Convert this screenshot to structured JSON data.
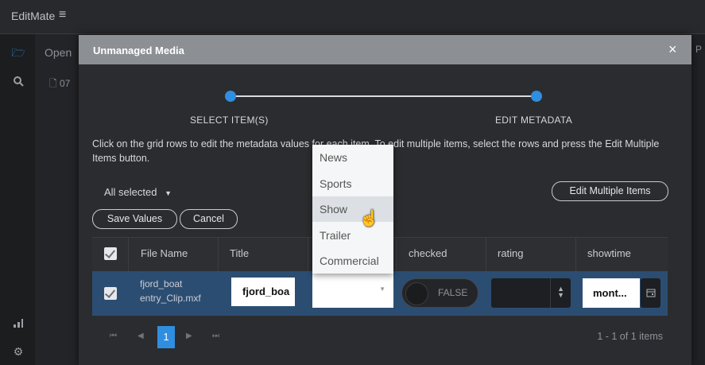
{
  "app": {
    "brand": "EditMate",
    "menu_icon": "hamburger-icon"
  },
  "background": {
    "tab_label": "Open",
    "row_label": "07",
    "right_label": "P"
  },
  "modal": {
    "title": "Unmanaged Media",
    "close_label": "×",
    "steps": [
      {
        "label": "SELECT ITEM(S)"
      },
      {
        "label": "EDIT METADATA"
      }
    ],
    "instructions": "Click on the grid rows to edit the metadata values for each item. To edit multiple items, select the rows and press the Edit Multiple Items button.",
    "selection_label": "All selected",
    "edit_multiple_label": "Edit Multiple Items",
    "save_label": "Save Values",
    "cancel_label": "Cancel"
  },
  "grid": {
    "columns": [
      "File Name",
      "Title",
      "",
      "checked",
      "rating",
      "showtime"
    ],
    "rows": [
      {
        "file_name": "fjord_boat entry_Clip.mxf",
        "title": "fjord_boa",
        "category": "",
        "checked": "FALSE",
        "rating": "",
        "showtime": "mont..."
      }
    ]
  },
  "dropdown": {
    "options": [
      "News",
      "Sports",
      "Show",
      "Trailer",
      "Commercial"
    ],
    "hovered": "Show"
  },
  "pager": {
    "current_page": "1",
    "info": "1 - 1 of 1 items"
  },
  "colors": {
    "accent": "#2f8ee0",
    "row_selected": "#2c4d72",
    "header": "#8c8f93"
  }
}
